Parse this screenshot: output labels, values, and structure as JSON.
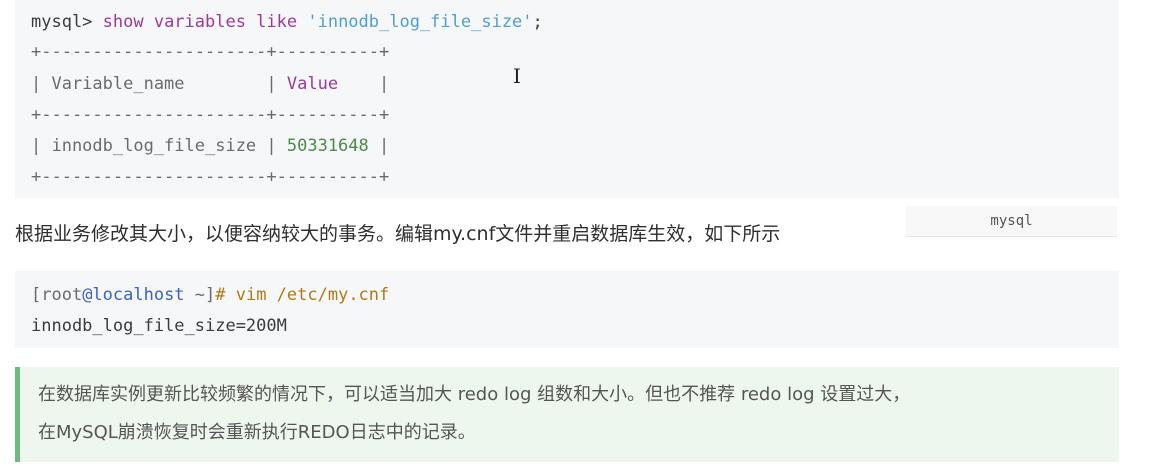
{
  "code_block_1": {
    "lines": [
      {
        "parts": [
          {
            "cls": "prompt",
            "text": "mysql> "
          },
          {
            "cls": "kw",
            "text": "show variables like "
          },
          {
            "cls": "str",
            "text": "'innodb_log_file_size'"
          },
          {
            "cls": "prompt",
            "text": ";"
          }
        ]
      },
      {
        "parts": [
          {
            "cls": "mut",
            "text": "+----------------------+----------+"
          }
        ]
      },
      {
        "parts": [
          {
            "cls": "mut",
            "text": "| Variable_name        | "
          },
          {
            "cls": "kw",
            "text": "Value"
          },
          {
            "cls": "mut",
            "text": "    |"
          }
        ]
      },
      {
        "parts": [
          {
            "cls": "mut",
            "text": "+----------------------+----------+"
          }
        ]
      },
      {
        "parts": [
          {
            "cls": "mut",
            "text": "| innodb_log_file_size | "
          },
          {
            "cls": "num",
            "text": "50331648"
          },
          {
            "cls": "mut",
            "text": " |"
          }
        ]
      },
      {
        "parts": [
          {
            "cls": "mut",
            "text": "+----------------------+----------+"
          }
        ]
      }
    ]
  },
  "paragraph": "根据业务修改其大小，以便容纳较大的事务。编辑my.cnf文件并重启数据库生效，如下所示",
  "language_label": "mysql",
  "code_block_2": {
    "lines": [
      {
        "parts": [
          {
            "cls": "mut",
            "text": "[root"
          },
          {
            "cls": "at",
            "text": "@localhost"
          },
          {
            "cls": "mut",
            "text": " ~]"
          },
          {
            "cls": "cmd",
            "text": "# vim /etc/my.cnf"
          }
        ]
      },
      {
        "parts": [
          {
            "cls": "prompt",
            "text": "innodb_log_file_size=200M"
          }
        ]
      }
    ]
  },
  "tip": {
    "line1": "在数据库实例更新比较频繁的情况下，可以适当加大 redo log 组数和大小。但也不推荐 redo log 设置过大，",
    "line2": "在MySQL崩溃恢复时会重新执行REDO日志中的记录。"
  },
  "cursor_glyph": "I"
}
